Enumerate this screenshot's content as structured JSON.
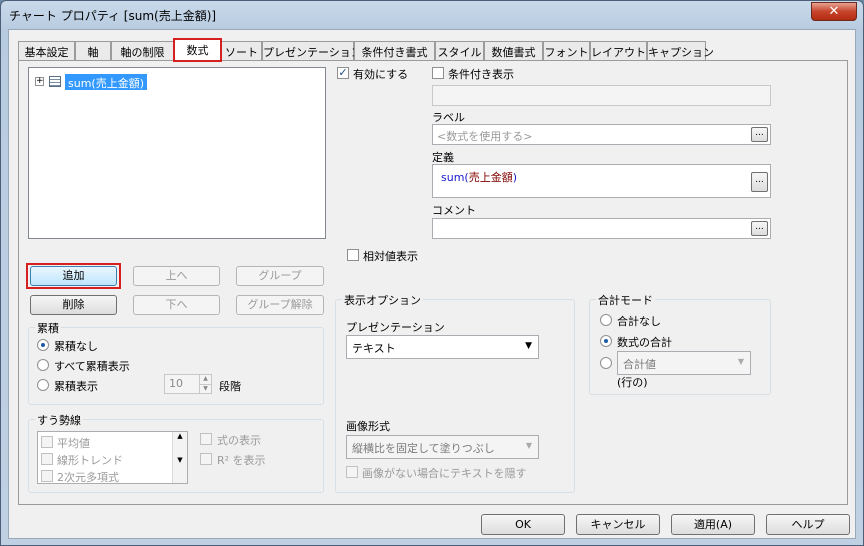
{
  "window": {
    "title": "チャート プロパティ [sum(売上金額)]",
    "close_label": "✕"
  },
  "tabs": [
    {
      "label": "基本設定"
    },
    {
      "label": "軸"
    },
    {
      "label": "軸の制限"
    },
    {
      "label": "数式"
    },
    {
      "label": "ソート"
    },
    {
      "label": "プレゼンテーション"
    },
    {
      "label": "条件付き書式"
    },
    {
      "label": "スタイル"
    },
    {
      "label": "数値書式"
    },
    {
      "label": "フォント"
    },
    {
      "label": "レイアウト"
    },
    {
      "label": "キャプション"
    }
  ],
  "active_tab": "数式",
  "expression_list": {
    "items": [
      {
        "label": "sum(売上金額)",
        "expander": "+"
      }
    ]
  },
  "list_buttons": {
    "add": "追加",
    "up": "上へ",
    "group": "グループ",
    "delete": "削除",
    "down": "下へ",
    "ungroup": "グループ解除"
  },
  "accumulation": {
    "title": "累積",
    "options": [
      "累積なし",
      "すべて累積表示",
      "累積表示"
    ],
    "selected": "累積なし",
    "steps_value": "10",
    "steps_label": "段階"
  },
  "trendline": {
    "title": "すう勢線",
    "items": [
      "平均値",
      "線形トレンド",
      "2次元多項式"
    ],
    "show_equation": "式の表示",
    "show_r2": "R² を表示"
  },
  "right": {
    "enable_label": "有効にする",
    "enable_checked": true,
    "conditional_label": "条件付き表示",
    "conditional_checked": false,
    "label_title": "ラベル",
    "label_placeholder": "<数式を使用する>",
    "definition_title": "定義",
    "definition_func": "sum(",
    "definition_field": "売上金額",
    "definition_close": ")",
    "comment_title": "コメント",
    "relative_label": "相対値表示",
    "dots": "..."
  },
  "display_options": {
    "title": "表示オプション",
    "presentation_label": "プレゼンテーション",
    "presentation_value": "テキスト",
    "image_format_label": "画像形式",
    "image_format_value": "縦横比を固定して塗りつぶし",
    "hide_text_label": "画像がない場合にテキストを隠す"
  },
  "total_mode": {
    "title": "合計モード",
    "options": [
      "合計なし",
      "数式の合計"
    ],
    "selected": "数式の合計",
    "aggregate_value": "合計値",
    "row_label": "(行の)"
  },
  "dialog_buttons": {
    "ok": "OK",
    "cancel": "キャンセル",
    "apply": "適用(A)",
    "help": "ヘルプ"
  },
  "colors": {
    "highlight": "#d62020",
    "selection": "#3399ff",
    "func_blue": "#1b1bd0",
    "field_maroon": "#800000"
  }
}
